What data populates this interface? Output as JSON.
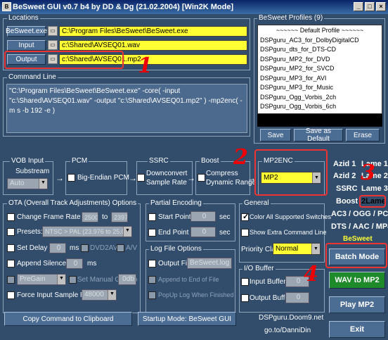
{
  "window": {
    "title": "BeSweet GUI v0.7 b4 by DD & Dg (21.02.2004)  [Win2K Mode]",
    "btns": [
      "_",
      "□",
      "×"
    ]
  },
  "locations": {
    "label": "Locations",
    "besweet_btn": "BeSweet.exe",
    "besweet_path": "C:\\Program Files\\BeSweet\\BeSweet.exe",
    "input_btn": "Input",
    "input_path": "c:\\Shared\\AVSEQ01.wav",
    "output_btn": "Output",
    "output_path": "c:\\Shared\\AVSEQ01.mp2"
  },
  "command_line": {
    "label": "Command Line",
    "text": "\"C:\\Program Files\\BeSweet\\BeSweet.exe\" -core( -input \"c:\\Shared\\AVSEQ01.wav\" -output \"c:\\Shared\\AVSEQ01.mp2\" ) -mp2enc( -m s -b 192 -e )"
  },
  "profiles": {
    "label": "BeSweet Profiles (9)",
    "items": [
      "~~~~~~ Default Profile ~~~~~~",
      "DSPguru_AC3_for_DolbyDigitalCD",
      "DSPguru_dts_for_DTS-CD",
      "DSPguru_MP2_for_DVD",
      "DSPguru_MP2_for_SVCD",
      "DSPguru_MP3_for_AVI",
      "DSPguru_MP3_for_Music",
      "DSPguru_Ogg_Vorbis_2ch",
      "DSPguru_Ogg_Vorbis_6ch"
    ],
    "save": "Save",
    "save_default": "Save as Default",
    "erase": "Erase"
  },
  "vob": {
    "label": "VOB Input",
    "substream_label": "Substream",
    "substream_value": "Auto"
  },
  "pcm": {
    "label": "PCM",
    "bigendian": "Big-Endian PCM"
  },
  "ssrc": {
    "label": "SSRC",
    "downconvert": "Downconvert",
    "sample_rate": "Sample Rate"
  },
  "boost": {
    "label": "Boost",
    "compress": "Compress",
    "dynamic": "Dynamic Range"
  },
  "mp2enc": {
    "label": "MP2ENC",
    "value": "MP2"
  },
  "presets": {
    "azid1": "Azid 1",
    "lame1": "Lame 1",
    "azid2": "Azid 2",
    "lame2": "Lame 2",
    "ssrc": "SSRC",
    "lame3": "Lame 3",
    "boost": "Boost",
    "lame2b": "2Lame",
    "ac3": "AC3 / OGG / PCM",
    "dts": "DTS / AAC / MP4",
    "besweet": "BeSweet"
  },
  "ota": {
    "label": "OTA (Overall Track Adjustments) Options",
    "change_rate": "Change Frame Rate from",
    "rate_from": "25000",
    "to": "to",
    "rate_to": "23976",
    "presets_label": "Presets:",
    "presets_value": "NTSC > PAL   (23.976 to 25.000)",
    "delay_label": "Set Delay to",
    "delay_value": "0",
    "ms": "ms",
    "dvd2avi": "DVD2AVI",
    "av": "A/V",
    "silence_label": "Append Silence of",
    "silence_value": "0",
    "ms2": "ms",
    "pregain": "PreGain",
    "manual_gain": "Set Manual Gain to",
    "gain_value": "0",
    "db": "0db",
    "force_label": "Force Input Sample Rate",
    "force_value": "48000"
  },
  "partial": {
    "label": "Partial Encoding",
    "start": "Start Point =",
    "start_value": "0",
    "sec": "sec",
    "end": "End Point =",
    "end_value": "0",
    "sec2": "sec"
  },
  "logfile": {
    "label": "Log File Options",
    "output": "Output File",
    "output_value": "BeSweet.log",
    "append": "Append to End of File",
    "popup": "PopUp Log When Finished"
  },
  "general": {
    "label": "General",
    "color": "Color All Supported Switches",
    "extra": "Show Extra Command Line",
    "priority_label": "Priority Class",
    "priority_value": "Normal"
  },
  "io": {
    "label": "I/O Buffer",
    "input": "Input Buffer",
    "input_value": "0",
    "output": "Output Buffer",
    "output_value": "0"
  },
  "bottom": {
    "copy": "Copy Command to Clipboard",
    "startup": "Startup Mode: BeSweet GUI",
    "dspguru": "DSPguru.Doom9.net",
    "goto": "go.to/DanniDin"
  },
  "actions": {
    "batch": "Batch Mode",
    "wav2mp2": "WAV to MP2",
    "play": "Play MP2",
    "exit": "Exit"
  },
  "annotations": {
    "n1": "1",
    "n2": "2",
    "n3": "3",
    "n4": "4"
  },
  "colors": {
    "bg": "#314d6b",
    "yellow": "#ffff33",
    "annotation": "#e00",
    "green_btn": "#1e8a2a"
  }
}
